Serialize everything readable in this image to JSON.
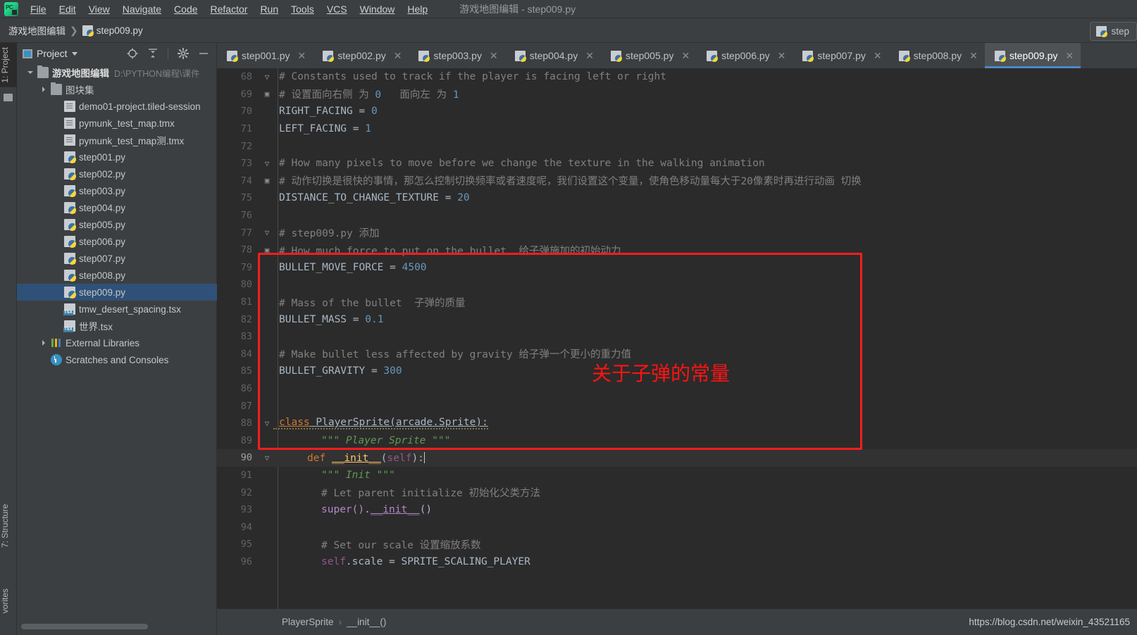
{
  "window": {
    "title": "游戏地图编辑 - step009.py",
    "logo_icon": "pycharm-logo-icon"
  },
  "menu": {
    "items": [
      {
        "label": "File"
      },
      {
        "label": "Edit"
      },
      {
        "label": "View"
      },
      {
        "label": "Navigate"
      },
      {
        "label": "Code"
      },
      {
        "label": "Refactor"
      },
      {
        "label": "Run"
      },
      {
        "label": "Tools"
      },
      {
        "label": "VCS"
      },
      {
        "label": "Window"
      },
      {
        "label": "Help"
      }
    ]
  },
  "navbar": {
    "project_name": "游戏地图编辑",
    "separator": "❯",
    "file_name": "step009.py",
    "run_config": "step"
  },
  "left_strip": {
    "top_tab": "1: Project",
    "bottom_tabs": [
      "7: Structure",
      "vorites"
    ]
  },
  "project_panel": {
    "title": "Project",
    "tools": [
      "locate-icon",
      "collapse-all-icon",
      "settings-gear-icon",
      "minimize-icon"
    ],
    "tree": [
      {
        "label": "游戏地图编辑",
        "path": "D:\\PYTHON编程\\课件",
        "icon": "folder",
        "arrow": "down",
        "indent": 0,
        "selected": false
      },
      {
        "label": "图块集",
        "path": "",
        "icon": "folder",
        "arrow": "right",
        "indent": 1,
        "selected": false
      },
      {
        "label": "demo01-project.tiled-session",
        "path": "",
        "icon": "file",
        "arrow": "none",
        "indent": 2,
        "selected": false
      },
      {
        "label": "pymunk_test_map.tmx",
        "path": "",
        "icon": "file",
        "arrow": "none",
        "indent": 2,
        "selected": false
      },
      {
        "label": "pymunk_test_map测.tmx",
        "path": "",
        "icon": "file",
        "arrow": "none",
        "indent": 2,
        "selected": false
      },
      {
        "label": "step001.py",
        "path": "",
        "icon": "py",
        "arrow": "none",
        "indent": 2,
        "selected": false
      },
      {
        "label": "step002.py",
        "path": "",
        "icon": "py",
        "arrow": "none",
        "indent": 2,
        "selected": false
      },
      {
        "label": "step003.py",
        "path": "",
        "icon": "py",
        "arrow": "none",
        "indent": 2,
        "selected": false
      },
      {
        "label": "step004.py",
        "path": "",
        "icon": "py",
        "arrow": "none",
        "indent": 2,
        "selected": false
      },
      {
        "label": "step005.py",
        "path": "",
        "icon": "py",
        "arrow": "none",
        "indent": 2,
        "selected": false
      },
      {
        "label": "step006.py",
        "path": "",
        "icon": "py",
        "arrow": "none",
        "indent": 2,
        "selected": false
      },
      {
        "label": "step007.py",
        "path": "",
        "icon": "py",
        "arrow": "none",
        "indent": 2,
        "selected": false
      },
      {
        "label": "step008.py",
        "path": "",
        "icon": "py",
        "arrow": "none",
        "indent": 2,
        "selected": false
      },
      {
        "label": "step009.py",
        "path": "",
        "icon": "py",
        "arrow": "none",
        "indent": 2,
        "selected": true
      },
      {
        "label": "tmw_desert_spacing.tsx",
        "path": "",
        "icon": "tsx",
        "arrow": "none",
        "indent": 2,
        "selected": false
      },
      {
        "label": "世界.tsx",
        "path": "",
        "icon": "tsx",
        "arrow": "none",
        "indent": 2,
        "selected": false
      },
      {
        "label": "External Libraries",
        "path": "",
        "icon": "lib",
        "arrow": "right",
        "indent": 1,
        "selected": false
      },
      {
        "label": "Scratches and Consoles",
        "path": "",
        "icon": "scratch",
        "arrow": "none",
        "indent": 1,
        "selected": false
      }
    ]
  },
  "editor": {
    "tabs": [
      {
        "label": "step001.py",
        "active": false
      },
      {
        "label": "step002.py",
        "active": false
      },
      {
        "label": "step003.py",
        "active": false
      },
      {
        "label": "step004.py",
        "active": false
      },
      {
        "label": "step005.py",
        "active": false
      },
      {
        "label": "step006.py",
        "active": false
      },
      {
        "label": "step007.py",
        "active": false
      },
      {
        "label": "step008.py",
        "active": false
      },
      {
        "label": "step009.py",
        "active": true
      }
    ],
    "close_icon": "✕",
    "lines": [
      {
        "num": "68",
        "fold": "▽",
        "current": false
      },
      {
        "num": "69",
        "fold": "▣",
        "current": false
      },
      {
        "num": "70",
        "fold": "",
        "current": false
      },
      {
        "num": "71",
        "fold": "",
        "current": false
      },
      {
        "num": "72",
        "fold": "",
        "current": false
      },
      {
        "num": "73",
        "fold": "▽",
        "current": false
      },
      {
        "num": "74",
        "fold": "▣",
        "current": false
      },
      {
        "num": "75",
        "fold": "",
        "current": false
      },
      {
        "num": "76",
        "fold": "",
        "current": false
      },
      {
        "num": "77",
        "fold": "▽",
        "current": false
      },
      {
        "num": "78",
        "fold": "▣",
        "current": false
      },
      {
        "num": "79",
        "fold": "",
        "current": false
      },
      {
        "num": "80",
        "fold": "",
        "current": false
      },
      {
        "num": "81",
        "fold": "",
        "current": false
      },
      {
        "num": "82",
        "fold": "",
        "current": false
      },
      {
        "num": "83",
        "fold": "",
        "current": false
      },
      {
        "num": "84",
        "fold": "",
        "current": false
      },
      {
        "num": "85",
        "fold": "",
        "current": false
      },
      {
        "num": "86",
        "fold": "",
        "current": false
      },
      {
        "num": "87",
        "fold": "",
        "current": false
      },
      {
        "num": "88",
        "fold": "▽",
        "current": false
      },
      {
        "num": "89",
        "fold": "",
        "current": false
      },
      {
        "num": "90",
        "fold": "▽",
        "current": true
      },
      {
        "num": "91",
        "fold": "",
        "current": false
      },
      {
        "num": "92",
        "fold": "",
        "current": false
      },
      {
        "num": "93",
        "fold": "",
        "current": false
      },
      {
        "num": "94",
        "fold": "",
        "current": false
      },
      {
        "num": "95",
        "fold": "",
        "current": false
      },
      {
        "num": "96",
        "fold": "",
        "current": false
      }
    ],
    "source": {
      "l68": "# Constants used to track if the player is facing left or right",
      "l69_a": "# 设置面向右侧 为 ",
      "l69_b": "0",
      "l69_c": "   面向左 为 ",
      "l69_d": "1",
      "l70_name": "RIGHT_FACING",
      "l70_val": "0",
      "l71_name": "LEFT_FACING",
      "l71_val": "1",
      "l73": "# How many pixels to move before we change the texture in the walking animation",
      "l74": "# 动作切换是很快的事情，那怎么控制切换频率或者速度呢，我们设置这个变量，使角色移动量每大于20像素时再进行动画 切换",
      "l75_name": "DISTANCE_TO_CHANGE_TEXTURE",
      "l75_val": "20",
      "l77": "# step009.py 添加",
      "l78": "# How much force to put on the bullet  给子弹施加的初始动力",
      "l79_name": "BULLET_MOVE_FORCE",
      "l79_val": "4500",
      "l81": "# Mass of the bullet  子弹的质量",
      "l82_name": "BULLET_MASS",
      "l82_val": "0.1",
      "l84": "# Make bullet less affected by gravity 给子弹一个更小的重力值",
      "l85_name": "BULLET_GRAVITY",
      "l85_val": "300",
      "l88_kw": "class",
      "l88_cls": "PlayerSprite",
      "l88_base": "(arcade.Sprite):",
      "l89": "\"\"\" Player Sprite \"\"\"",
      "l90_kw": "def",
      "l90_fn": "__init__",
      "l90_self": "self",
      "l91": "\"\"\" Init \"\"\"",
      "l92": "# Let parent initialize 初始化父类方法",
      "l93_a": "super()",
      "l93_b": ".",
      "l93_c": "__init__",
      "l93_d": "()",
      "l95": "# Set our scale 设置缩放系数",
      "l96_a": "self",
      "l96_b": ".scale = SPRITE_SCALING_PLAYER"
    },
    "annotation": {
      "text": "关于子弹的常量",
      "color": "#ff1313",
      "box_color": "#ff1d1d"
    }
  },
  "status": {
    "breadcrumb": [
      "PlayerSprite",
      "__init__()"
    ],
    "separator": "›",
    "watermark": "https://blog.csdn.net/weixin_43521165"
  }
}
